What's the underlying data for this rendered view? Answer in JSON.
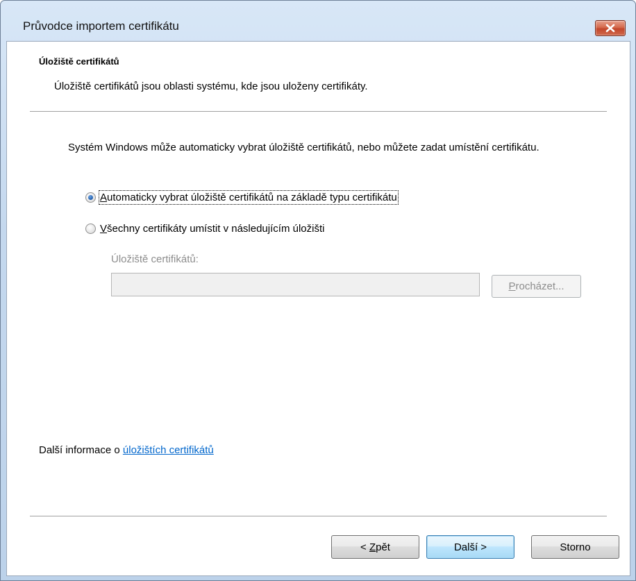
{
  "window": {
    "title": "Průvodce importem certifikátu",
    "close_icon": "close-icon"
  },
  "header": {
    "title": "Úložiště certifikátů",
    "subtitle": "Úložiště certifikátů jsou oblasti systému, kde jsou uloženy certifikáty."
  },
  "body": {
    "intro": "Systém Windows může automaticky vybrat úložiště certifikátů, nebo můžete zadat umístění certifikátu.",
    "options": [
      {
        "label_first": "A",
        "label_rest": "utomaticky vybrat úložiště certifikátů na základě typu certifikátu",
        "checked": true
      },
      {
        "label_first": "V",
        "label_rest": "šechny certifikáty umístit v následujícím úložišti",
        "checked": false
      }
    ],
    "store_label": "Úložiště certifikátů:",
    "store_value": "",
    "browse_first": "P",
    "browse_rest": "rocházet..."
  },
  "footer_info": {
    "prefix": "Další informace o ",
    "link": "úložištích certifikátů"
  },
  "buttons": {
    "back_pre": "< ",
    "back_u": "Z",
    "back_rest": "pět",
    "next": "Další >",
    "cancel": "Storno"
  },
  "colors": {
    "link": "#0066cc",
    "disabled_text": "#8d8d8d",
    "default_button_border": "#3c7fb1",
    "close_button": "#c3462b"
  }
}
